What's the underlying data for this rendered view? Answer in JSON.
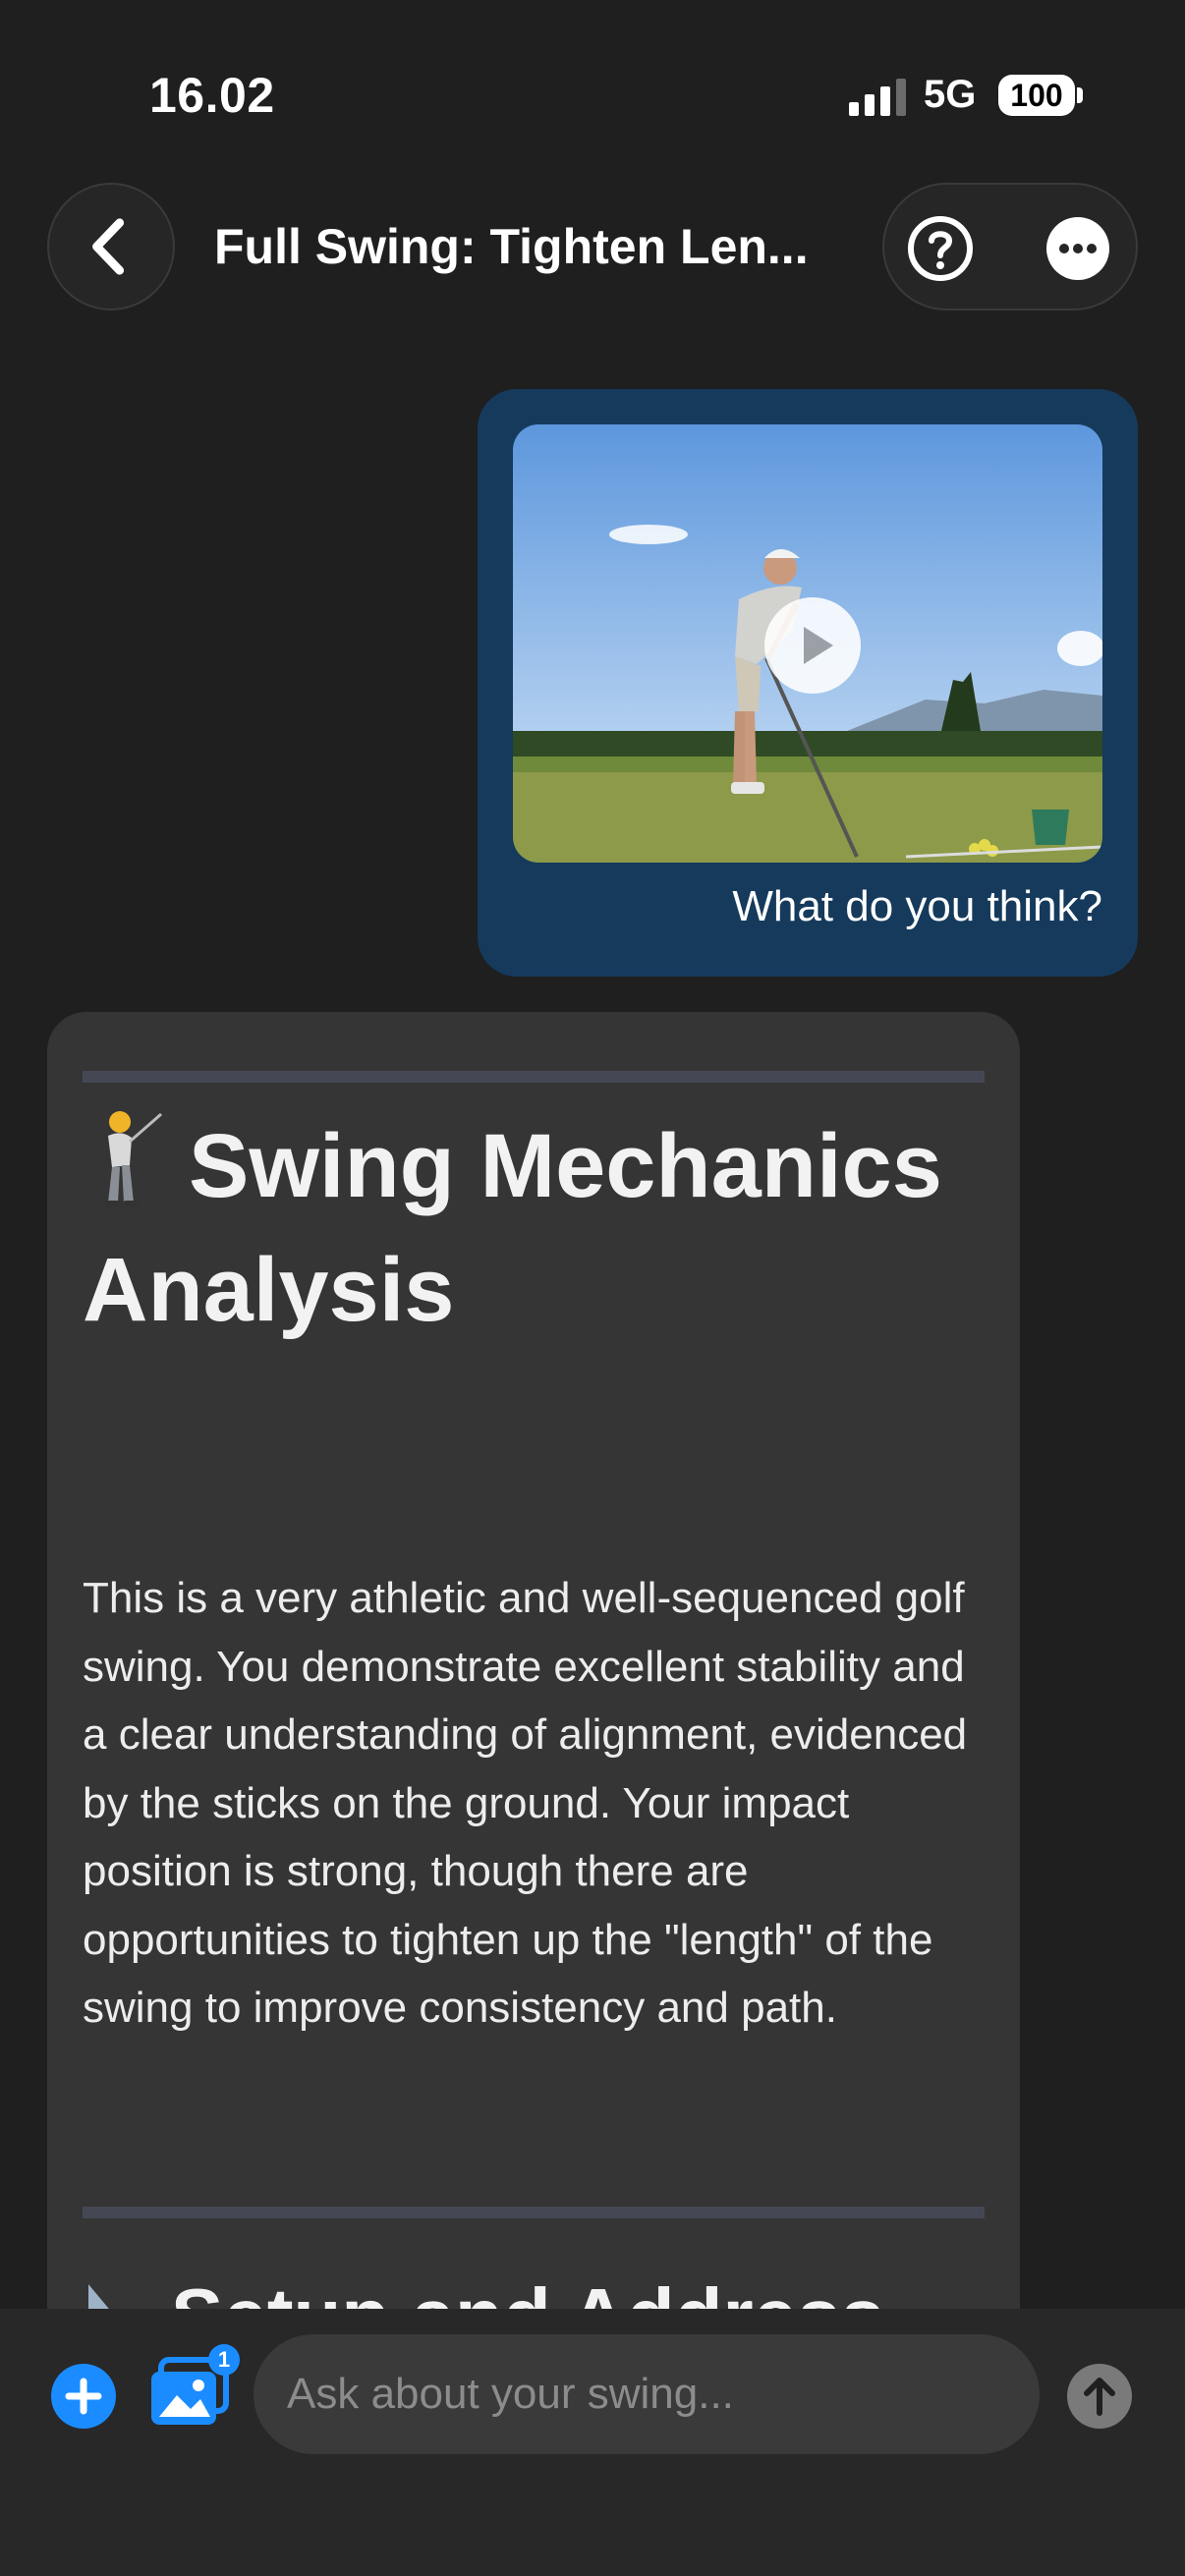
{
  "status_bar": {
    "time": "16.02",
    "network": "5G",
    "battery": "100"
  },
  "nav": {
    "title": "Full Swing: Tighten Len..."
  },
  "messages": {
    "user": {
      "text": "What do you think?"
    },
    "assistant": {
      "heading": "Swing Mechanics Analysis",
      "body": "This is a very athletic and well-sequenced golf swing. You demonstrate excellent stability and a clear understanding of alignment, evidenced by the sticks on the ground. Your impact position is strong, though there are opportunities to tighten up the \"length\" of the swing to improve consistency and path.",
      "next_heading": "Setup and Address"
    }
  },
  "composer": {
    "placeholder": "Ask about your swing...",
    "attachment_count": "1"
  },
  "colors": {
    "background": "#1f1f1f",
    "user_bubble": "#153a5c",
    "assistant_card": "#353535",
    "accent": "#1a8cff"
  }
}
